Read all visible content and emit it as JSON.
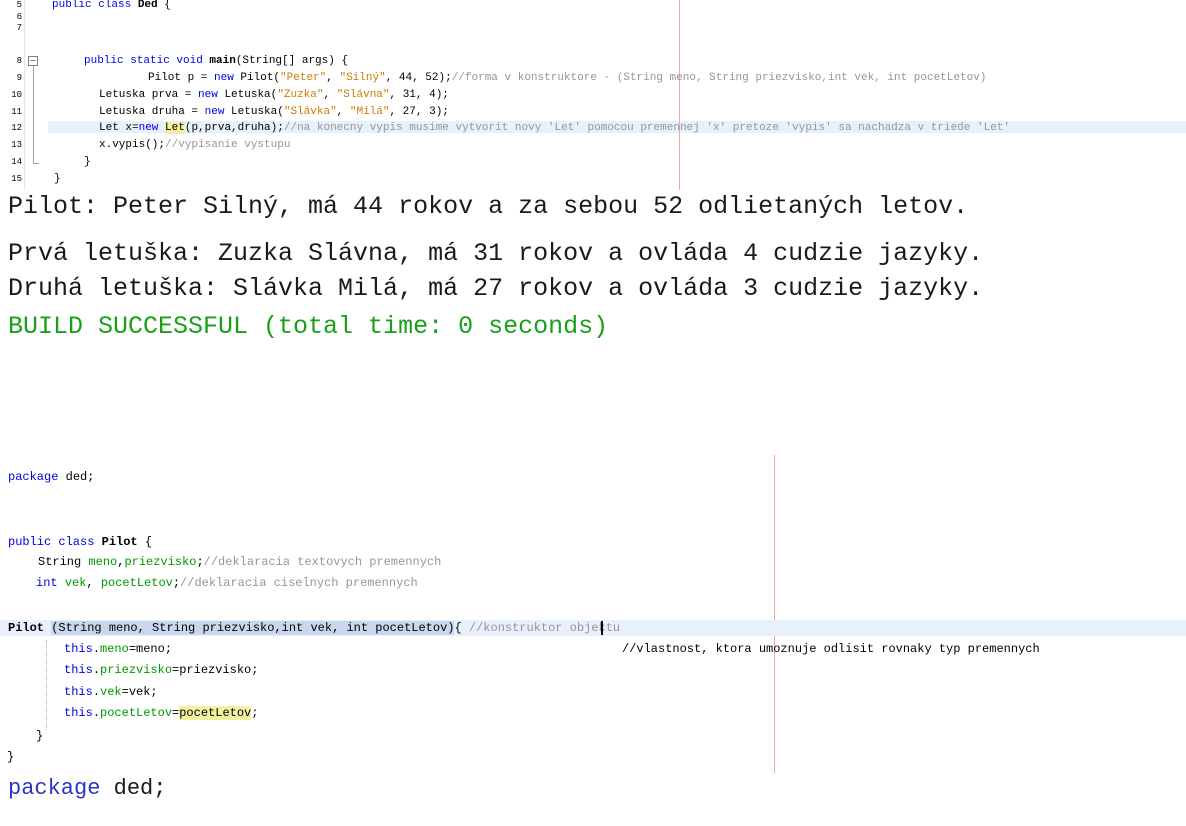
{
  "editor1": {
    "line_numbers": [
      "5",
      "6",
      "7",
      "8",
      "9",
      "10",
      "11",
      "12",
      "13",
      "14",
      "15"
    ],
    "fold_symbol": "−",
    "lines": {
      "l5": {
        "kw1": "public class ",
        "name": "Ded",
        "rest": " {"
      },
      "l8": {
        "kw1": "public static void ",
        "method": "main",
        "rest": "(String[] args) {"
      },
      "l9": {
        "pre": "Pilot p = ",
        "kw": "new",
        "mid": " Pilot(",
        "s1": "\"Peter\"",
        "c1": ", ",
        "s2": "\"Silný\"",
        "rest": ", 44, 52);",
        "comment": "//forma v konstruktore - (String meno, String priezvisko,int vek, int pocetLetov)"
      },
      "l10": {
        "pre": "Letuska prva = ",
        "kw": "new",
        "mid": " Letuska(",
        "s1": "\"Zuzka\"",
        "c1": ", ",
        "s2": "\"Slávna\"",
        "rest": ", 31, 4);"
      },
      "l11": {
        "pre": "Letuska druha = ",
        "kw": "new",
        "mid": " Letuska(",
        "s1": "\"Slávka\"",
        "c1": ", ",
        "s2": "\"Milá\"",
        "rest": ", 27, 3);"
      },
      "l12": {
        "pre": "Let x=",
        "kw": "new",
        "sp": " ",
        "cls": "Let",
        "rest": "(p,prva,druha);",
        "comment": "//na konecny vypis musime vytvorit novy 'Let' pomocou premennej 'x' pretoze 'vypis' sa nachadza v triede 'Let'"
      },
      "l13": {
        "code": "x.vypis();",
        "comment": "//vypisanie vystupu"
      },
      "l14": {
        "code": "}"
      },
      "l15": {
        "code": "}"
      }
    }
  },
  "console": {
    "line1": "Pilot: Peter Silný, má 44 rokov a za sebou 52 odlietaných letov.",
    "line2": "Prvá letuška: Zuzka Slávna, má 31 rokov a ovláda 4 cudzie jazyky.",
    "line3": "Druhá letuška: Slávka Milá, má 27 rokov a ovláda 3 cudzie jazyky.",
    "build": "BUILD SUCCESSFUL (total time: 0 seconds)"
  },
  "editor2": {
    "pkg": {
      "kw": "package",
      "rest": " ded;"
    },
    "cls": {
      "kw": "public class ",
      "name": "Pilot",
      "rest": " {"
    },
    "f1": {
      "type": "String ",
      "a": "meno",
      "c": ",",
      "b": "priezvisko",
      "end": ";",
      "comment": "//deklaracia textovych premennych"
    },
    "f2": {
      "type": "int",
      "sp": " ",
      "a": "vek",
      "c": ", ",
      "b": "pocetLetov",
      "end": ";",
      "comment": "//deklaracia ciselnych premennych"
    },
    "ctor": {
      "name": "Pilot",
      "sp": " ",
      "sig": "(String meno, String priezvisko,int vek, int pocetLetov)",
      "brace": "{",
      "comment": " //konstruktor objektu"
    },
    "a1": {
      "kw": "this",
      "dot": ".",
      "f": "meno",
      "rest": "=meno;",
      "comment": "//vlastnost, ktora umoznuje odlisit rovnaky typ premennych"
    },
    "a2": {
      "kw": "this",
      "dot": ".",
      "f": "priezvisko",
      "rest": "=priezvisko;"
    },
    "a3": {
      "kw": "this",
      "dot": ".",
      "f": "vek",
      "rest": "=vek;"
    },
    "a4": {
      "kw": "this",
      "dot": ".",
      "f": "pocetLetov",
      "eq": "=",
      "hl": "pocetLetov",
      "end": ";"
    },
    "close1": "}",
    "close2": "}"
  },
  "bottom": {
    "kw": "package",
    "rest": " ded;"
  }
}
